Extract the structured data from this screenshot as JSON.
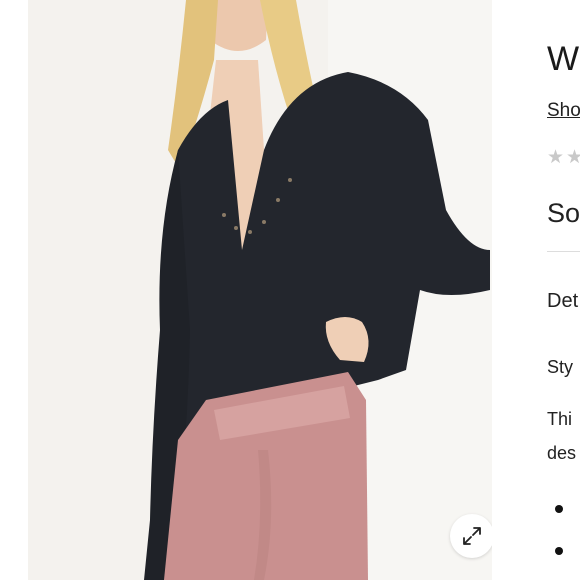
{
  "product": {
    "title": "W",
    "shop_link": "Sho",
    "rating_stars": "★★",
    "stock_status": "So",
    "details_heading": "Det",
    "style_label": "Sty",
    "description_line_1": "Thi",
    "description_line_2": "des"
  },
  "photo": {
    "subject": "model-wearing-black-henley-and-pink-satin-skirt",
    "expand_icon": "expand-arrows-icon"
  },
  "colors": {
    "photo_background": "#f4f2ee",
    "top": "#23262d",
    "skirt": "#c9908f",
    "hair": "#e2c27c",
    "skin": "#efcfb6",
    "star_empty": "#c9c9c9"
  }
}
